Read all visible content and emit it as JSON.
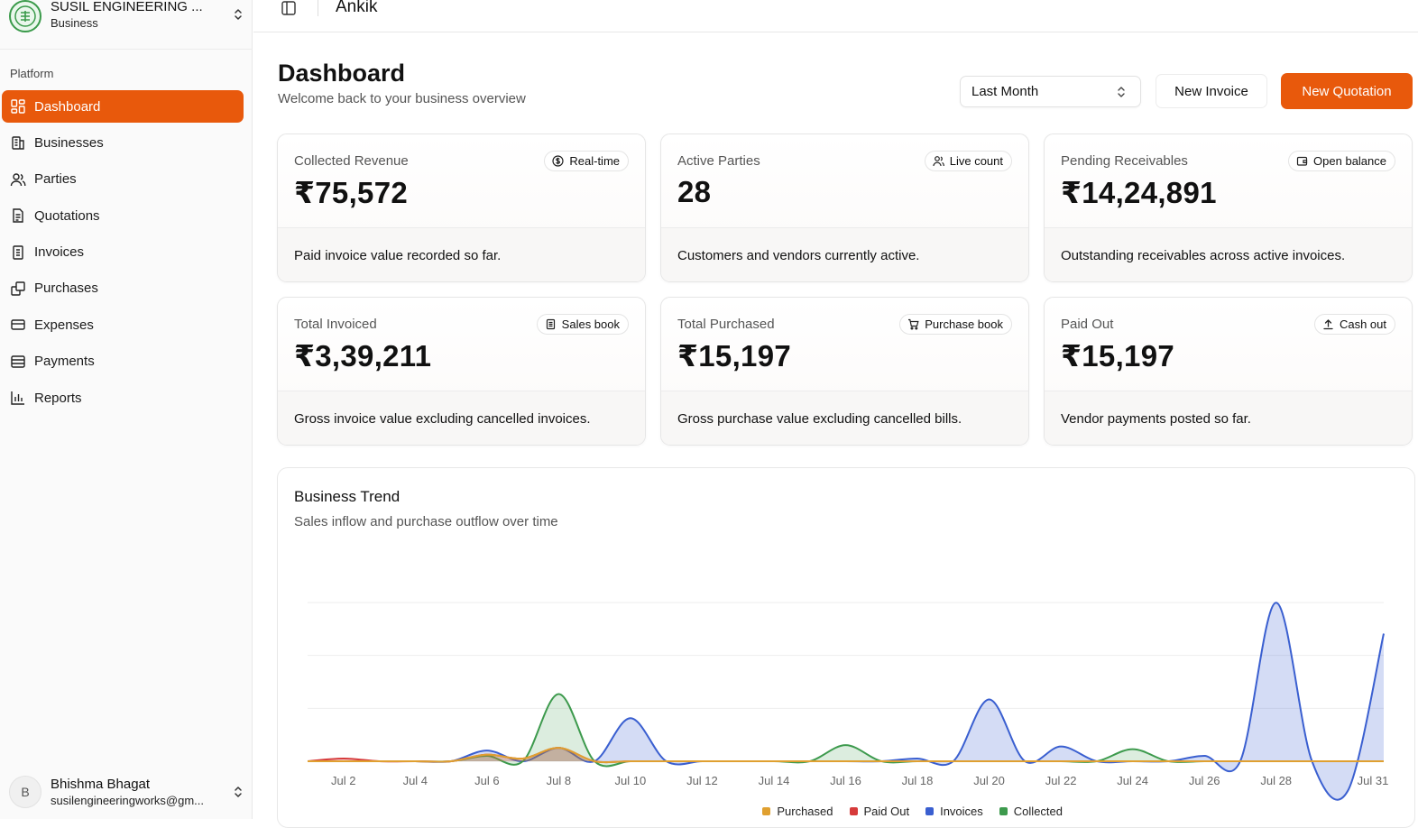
{
  "org": {
    "name": "SUSIL ENGINEERING ...",
    "type": "Business"
  },
  "sidebar": {
    "section": "Platform",
    "items": [
      {
        "label": "Dashboard",
        "icon": "dashboard-icon"
      },
      {
        "label": "Businesses",
        "icon": "building-icon"
      },
      {
        "label": "Parties",
        "icon": "users-icon"
      },
      {
        "label": "Quotations",
        "icon": "document-icon"
      },
      {
        "label": "Invoices",
        "icon": "receipt-icon"
      },
      {
        "label": "Purchases",
        "icon": "copy-icon"
      },
      {
        "label": "Expenses",
        "icon": "card-icon"
      },
      {
        "label": "Payments",
        "icon": "wallet-icon"
      },
      {
        "label": "Reports",
        "icon": "bar-chart-icon"
      }
    ]
  },
  "user": {
    "initial": "B",
    "name": "Bhishma Bhagat",
    "email": "susilengineeringworks@gm..."
  },
  "topbar": {
    "title": "Ankik"
  },
  "header": {
    "title": "Dashboard",
    "subtitle": "Welcome back to your business overview",
    "period": "Last Month",
    "new_invoice": "New Invoice",
    "new_quotation": "New Quotation"
  },
  "cards": [
    {
      "label": "Collected Revenue",
      "value": "₹75,572",
      "badge": "Real-time",
      "badge_icon": "dollar-circle-icon",
      "foot": "Paid invoice value recorded so far."
    },
    {
      "label": "Active Parties",
      "value": "28",
      "badge": "Live count",
      "badge_icon": "users-icon",
      "foot": "Customers and vendors currently active."
    },
    {
      "label": "Pending Receivables",
      "value": "₹14,24,891",
      "badge": "Open balance",
      "badge_icon": "wallet-icon",
      "foot": "Outstanding receivables across active invoices."
    },
    {
      "label": "Total Invoiced",
      "value": "₹3,39,211",
      "badge": "Sales book",
      "badge_icon": "receipt-icon",
      "foot": "Gross invoice value excluding cancelled invoices."
    },
    {
      "label": "Total Purchased",
      "value": "₹15,197",
      "badge": "Purchase book",
      "badge_icon": "cart-icon",
      "foot": "Gross purchase value excluding cancelled bills."
    },
    {
      "label": "Paid Out",
      "value": "₹15,197",
      "badge": "Cash out",
      "badge_icon": "upload-icon",
      "foot": "Vendor payments posted so far."
    }
  ],
  "trend": {
    "title": "Business Trend",
    "subtitle": "Sales inflow and purchase outflow over time"
  },
  "chart_data": {
    "type": "area",
    "x": [
      "Jul 1",
      "Jul 2",
      "Jul 3",
      "Jul 4",
      "Jul 5",
      "Jul 6",
      "Jul 7",
      "Jul 8",
      "Jul 9",
      "Jul 10",
      "Jul 11",
      "Jul 12",
      "Jul 13",
      "Jul 14",
      "Jul 15",
      "Jul 16",
      "Jul 17",
      "Jul 18",
      "Jul 19",
      "Jul 20",
      "Jul 21",
      "Jul 22",
      "Jul 23",
      "Jul 24",
      "Jul 25",
      "Jul 26",
      "Jul 27",
      "Jul 28",
      "Jul 29",
      "Jul 30",
      "Jul 31"
    ],
    "tick_labels": [
      "Jul 2",
      "Jul 4",
      "Jul 6",
      "Jul 8",
      "Jul 10",
      "Jul 12",
      "Jul 14",
      "Jul 16",
      "Jul 18",
      "Jul 20",
      "Jul 22",
      "Jul 24",
      "Jul 26",
      "Jul 28",
      "Jul 31"
    ],
    "series": [
      {
        "name": "Purchased",
        "color": "#e0a030",
        "values": [
          0,
          0,
          0,
          0,
          0,
          0.05,
          0.02,
          0.1,
          0,
          0,
          0,
          0,
          0,
          0,
          0,
          0,
          0,
          0,
          0,
          0,
          0,
          0,
          0,
          0,
          0,
          0,
          0,
          0,
          0,
          0,
          0
        ]
      },
      {
        "name": "Paid Out",
        "color": "#d63a3a",
        "values": [
          0,
          0.02,
          0,
          0,
          0,
          0.05,
          0.02,
          0.1,
          0,
          0,
          0,
          0,
          0,
          0,
          0,
          0,
          0,
          0,
          0,
          0,
          0,
          0,
          0,
          0,
          0,
          0,
          0,
          0,
          0,
          0,
          0
        ]
      },
      {
        "name": "Invoices",
        "color": "#3a5fd0",
        "values": [
          0,
          0,
          0,
          0,
          0,
          0.08,
          0,
          0.1,
          0,
          0.32,
          0,
          0,
          0,
          0,
          0,
          0,
          0,
          0.02,
          0,
          0.46,
          0,
          0.11,
          0,
          0,
          0,
          0.04,
          0,
          1.18,
          0,
          -0.22,
          0.95
        ]
      },
      {
        "name": "Collected",
        "color": "#3d9a4d",
        "values": [
          0,
          0,
          0,
          0,
          0,
          0.04,
          0,
          0.5,
          0,
          0,
          0,
          0,
          0,
          0,
          0,
          0.12,
          0,
          0,
          0,
          0,
          0,
          0,
          0,
          0.09,
          0,
          0,
          0,
          0,
          0,
          0,
          0
        ]
      }
    ],
    "grid": true,
    "legend": "bottom"
  }
}
